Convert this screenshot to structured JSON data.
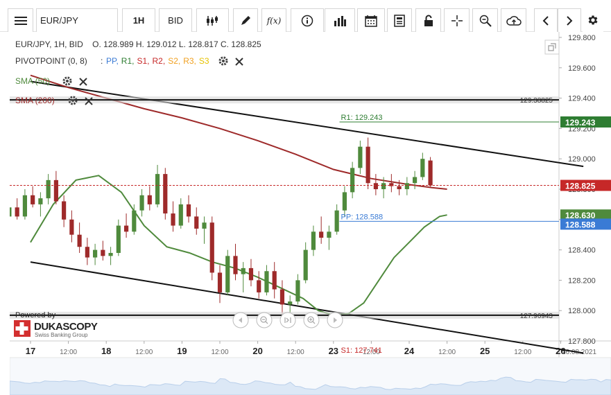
{
  "toolbar": {
    "instrument": "EUR/JPY",
    "period": "1H",
    "side": "BID"
  },
  "header": {
    "info_line": "EUR/JPY, 1H, BID    O. 128.989 H. 129.012 L. 128.817 C. 128.825",
    "pivot_name": "PIVOTPOINT (0, 8)",
    "pivot_sep": ":",
    "pivot_items": [
      {
        "label": "PP,",
        "color": "#3a7bd5"
      },
      {
        "label": "R1,",
        "color": "#2e7d32"
      },
      {
        "label": "S1,",
        "color": "#c62828"
      },
      {
        "label": "R2,",
        "color": "#c62828"
      },
      {
        "label": "S2,",
        "color": "#f0a020"
      },
      {
        "label": "R3,",
        "color": "#f0a020"
      },
      {
        "label": "S3",
        "color": "#e6c200"
      }
    ],
    "sma50": "SMA (50)",
    "sma200": "SMA (200)"
  },
  "branding": {
    "powered_by": "Powered by",
    "logo_text": "DUKASCOPY",
    "tagline": "Swiss Banking Group"
  },
  "colors": {
    "bull": "#4f8a3c",
    "bear": "#9e2a2a",
    "sma50": "#4f8a3c",
    "sma200": "#9e2a2a",
    "pp": "#3a7bd5",
    "r1": "#2e7d32",
    "s1": "#c62828",
    "current": "#c62828"
  },
  "chart_data": {
    "type": "candlestick",
    "y_axis": {
      "min": 127.8,
      "max": 129.8,
      "ticks": [
        "129.800",
        "129.600",
        "129.400",
        "129.200",
        "129.000",
        "128.800",
        "128.600",
        "128.400",
        "128.200",
        "128.000",
        "127.800"
      ]
    },
    "x_axis": {
      "day_labels": [
        {
          "text": "17",
          "pos": 0
        },
        {
          "text": "12:00",
          "pos": 0.5
        },
        {
          "text": "18",
          "pos": 1
        },
        {
          "text": "12:00",
          "pos": 1.5
        },
        {
          "text": "19",
          "pos": 2
        },
        {
          "text": "12:00",
          "pos": 2.5
        },
        {
          "text": "20",
          "pos": 3
        },
        {
          "text": "12:00",
          "pos": 3.5
        },
        {
          "text": "23",
          "pos": 4
        },
        {
          "text": "12:00",
          "pos": 4.5
        },
        {
          "text": "24",
          "pos": 5
        },
        {
          "text": "12:00",
          "pos": 5.5
        },
        {
          "text": "25",
          "pos": 6
        },
        {
          "text": "12:00",
          "pos": 6.5
        },
        {
          "text": "26",
          "pos": 7
        }
      ],
      "end_date": "26.08.2021"
    },
    "levels": {
      "upper_hline": {
        "value": 129.38825,
        "label": "129.38825"
      },
      "lower_hline": {
        "value": 127.96943,
        "label": "127.96943"
      },
      "r1": {
        "value": 129.243,
        "label": "R1: 129.243",
        "tag": "129.243"
      },
      "pp": {
        "value": 128.588,
        "label": "PP: 128.588",
        "tag": "128.588"
      },
      "s1": {
        "value": 127.741,
        "label": "S1: 127.741"
      },
      "sma50_tag": {
        "value": 128.63,
        "tag": "128.630"
      },
      "current": {
        "value": 128.825,
        "tag": "128.825"
      }
    },
    "channel": {
      "upper": [
        [
          0,
          129.51
        ],
        [
          7.3,
          128.95
        ]
      ],
      "lower": [
        [
          0,
          128.32
        ],
        [
          7.3,
          127.72
        ]
      ]
    },
    "sma50_series": [
      [
        0,
        128.45
      ],
      [
        0.3,
        128.7
      ],
      [
        0.6,
        128.86
      ],
      [
        0.9,
        128.89
      ],
      [
        1.2,
        128.78
      ],
      [
        1.5,
        128.56
      ],
      [
        1.8,
        128.42
      ],
      [
        2.1,
        128.38
      ],
      [
        2.4,
        128.32
      ],
      [
        2.7,
        128.28
      ],
      [
        3.0,
        128.22
      ],
      [
        3.3,
        128.15
      ],
      [
        3.6,
        128.08
      ],
      [
        3.8,
        128.0
      ],
      [
        4.0,
        127.97
      ],
      [
        4.2,
        127.98
      ],
      [
        4.4,
        128.05
      ],
      [
        4.6,
        128.2
      ],
      [
        4.8,
        128.35
      ],
      [
        5.0,
        128.45
      ],
      [
        5.2,
        128.55
      ],
      [
        5.4,
        128.62
      ],
      [
        5.5,
        128.63
      ]
    ],
    "sma200_series": [
      [
        0,
        129.55
      ],
      [
        0.5,
        129.47
      ],
      [
        1.0,
        129.4
      ],
      [
        1.5,
        129.33
      ],
      [
        2.0,
        129.27
      ],
      [
        2.5,
        129.2
      ],
      [
        3.0,
        129.12
      ],
      [
        3.5,
        129.03
      ],
      [
        4.0,
        128.93
      ],
      [
        4.5,
        128.87
      ],
      [
        5.0,
        128.83
      ],
      [
        5.3,
        128.81
      ],
      [
        5.5,
        128.8
      ]
    ],
    "candles": [
      [
        128.62,
        128.7,
        128.58,
        128.68
      ],
      [
        128.68,
        128.74,
        128.6,
        128.62
      ],
      [
        128.62,
        128.8,
        128.6,
        128.76
      ],
      [
        128.76,
        128.82,
        128.68,
        128.7
      ],
      [
        128.7,
        128.78,
        128.62,
        128.74
      ],
      [
        128.74,
        128.9,
        128.7,
        128.86
      ],
      [
        128.86,
        128.92,
        128.7,
        128.72
      ],
      [
        128.72,
        128.76,
        128.55,
        128.6
      ],
      [
        128.6,
        128.66,
        128.45,
        128.5
      ],
      [
        128.5,
        128.58,
        128.38,
        128.42
      ],
      [
        128.42,
        128.48,
        128.3,
        128.35
      ],
      [
        128.35,
        128.44,
        128.3,
        128.4
      ],
      [
        128.4,
        128.46,
        128.33,
        128.36
      ],
      [
        128.36,
        128.42,
        128.3,
        128.38
      ],
      [
        128.38,
        128.6,
        128.36,
        128.56
      ],
      [
        128.56,
        128.64,
        128.48,
        128.52
      ],
      [
        128.52,
        128.7,
        128.5,
        128.66
      ],
      [
        128.66,
        128.8,
        128.62,
        128.76
      ],
      [
        128.76,
        128.82,
        128.66,
        128.7
      ],
      [
        128.7,
        128.96,
        128.68,
        128.9
      ],
      [
        128.9,
        128.94,
        128.6,
        128.64
      ],
      [
        128.64,
        128.72,
        128.52,
        128.56
      ],
      [
        128.56,
        128.74,
        128.54,
        128.7
      ],
      [
        128.7,
        128.76,
        128.58,
        128.62
      ],
      [
        128.62,
        128.68,
        128.5,
        128.54
      ],
      [
        128.54,
        128.62,
        128.44,
        128.58
      ],
      [
        128.58,
        128.62,
        128.2,
        128.25
      ],
      [
        128.25,
        128.3,
        128.05,
        128.12
      ],
      [
        128.12,
        128.4,
        128.1,
        128.36
      ],
      [
        128.36,
        128.44,
        128.2,
        128.24
      ],
      [
        128.24,
        128.32,
        128.12,
        128.28
      ],
      [
        128.28,
        128.34,
        128.16,
        128.2
      ],
      [
        128.2,
        128.26,
        128.08,
        128.12
      ],
      [
        128.12,
        128.3,
        128.1,
        128.26
      ],
      [
        128.26,
        128.32,
        128.08,
        128.14
      ],
      [
        128.14,
        128.2,
        127.98,
        128.04
      ],
      [
        128.04,
        128.1,
        127.97,
        128.06
      ],
      [
        128.06,
        128.24,
        128.04,
        128.2
      ],
      [
        128.2,
        128.45,
        128.18,
        128.4
      ],
      [
        128.4,
        128.56,
        128.36,
        128.52
      ],
      [
        128.52,
        128.62,
        128.44,
        128.48
      ],
      [
        128.48,
        128.56,
        128.4,
        128.52
      ],
      [
        128.52,
        128.7,
        128.5,
        128.66
      ],
      [
        128.66,
        128.82,
        128.62,
        128.78
      ],
      [
        128.78,
        128.98,
        128.74,
        128.94
      ],
      [
        128.94,
        129.12,
        128.9,
        129.08
      ],
      [
        129.08,
        129.14,
        128.8,
        128.84
      ],
      [
        128.84,
        128.9,
        128.76,
        128.8
      ],
      [
        128.8,
        128.88,
        128.74,
        128.84
      ],
      [
        128.84,
        128.9,
        128.78,
        128.82
      ],
      [
        128.82,
        128.86,
        128.76,
        128.8
      ],
      [
        128.8,
        128.88,
        128.76,
        128.84
      ],
      [
        128.84,
        128.92,
        128.8,
        128.88
      ],
      [
        128.88,
        129.04,
        128.86,
        129.0
      ],
      [
        128.989,
        129.012,
        128.817,
        128.825
      ]
    ]
  }
}
